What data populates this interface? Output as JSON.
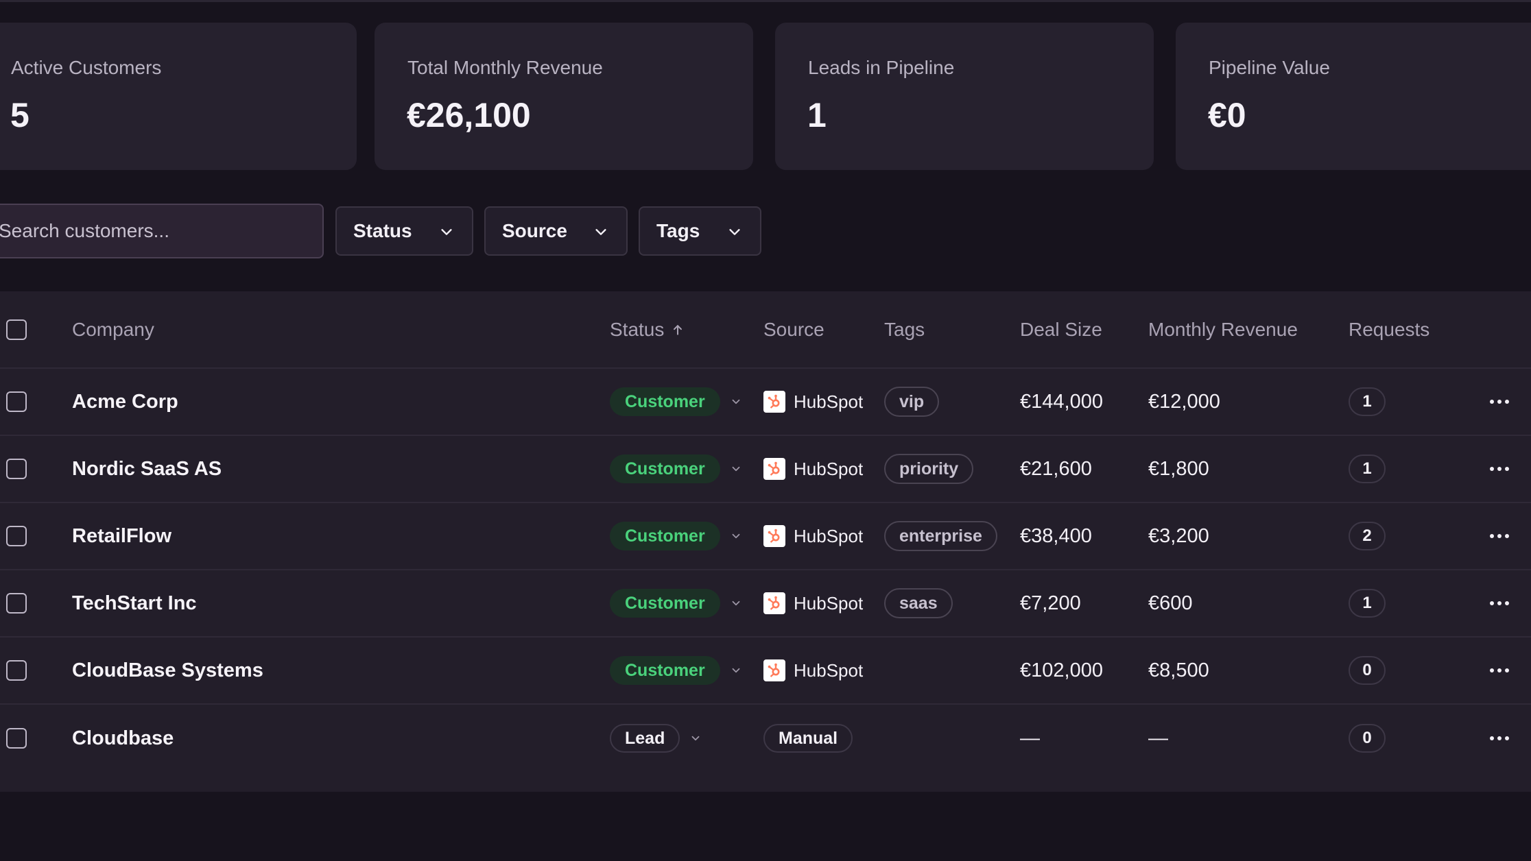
{
  "stats": [
    {
      "label": "Active Customers",
      "value": "5"
    },
    {
      "label": "Total Monthly Revenue",
      "value": "€26,100"
    },
    {
      "label": "Leads in Pipeline",
      "value": "1"
    },
    {
      "label": "Pipeline Value",
      "value": "€0"
    }
  ],
  "search": {
    "placeholder": "Search customers...",
    "value": ""
  },
  "filters": {
    "status": "Status",
    "source": "Source",
    "tags": "Tags"
  },
  "table": {
    "columns": {
      "company": "Company",
      "status": "Status",
      "status_sort_icon": "arrow-up-icon",
      "source": "Source",
      "tags": "Tags",
      "deal_size": "Deal Size",
      "monthly_revenue": "Monthly Revenue",
      "requests": "Requests"
    },
    "rows": [
      {
        "company": "Acme Corp",
        "status": "Customer",
        "source": "HubSpot",
        "tag": "vip",
        "deal_size": "€144,000",
        "monthly_revenue": "€12,000",
        "requests": "1"
      },
      {
        "company": "Nordic SaaS AS",
        "status": "Customer",
        "source": "HubSpot",
        "tag": "priority",
        "deal_size": "€21,600",
        "monthly_revenue": "€1,800",
        "requests": "1"
      },
      {
        "company": "RetailFlow",
        "status": "Customer",
        "source": "HubSpot",
        "tag": "enterprise",
        "deal_size": "€38,400",
        "monthly_revenue": "€3,200",
        "requests": "2"
      },
      {
        "company": "TechStart Inc",
        "status": "Customer",
        "source": "HubSpot",
        "tag": "saas",
        "deal_size": "€7,200",
        "monthly_revenue": "€600",
        "requests": "1"
      },
      {
        "company": "CloudBase Systems",
        "status": "Customer",
        "source": "HubSpot",
        "tag": "",
        "deal_size": "€102,000",
        "monthly_revenue": "€8,500",
        "requests": "0"
      },
      {
        "company": "Cloudbase",
        "status": "Lead",
        "source": "Manual",
        "tag": "",
        "deal_size": "—",
        "monthly_revenue": "—",
        "requests": "0"
      }
    ]
  },
  "colors": {
    "background": "#17131d",
    "card": "#26212e",
    "customer_green": "#4ad27c",
    "hubspot_orange": "#ff7a59"
  }
}
